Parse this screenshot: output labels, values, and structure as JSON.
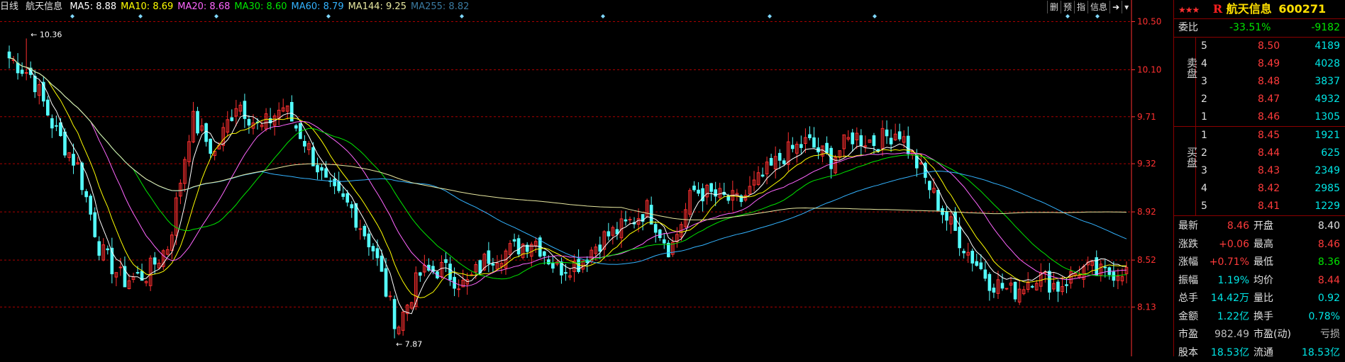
{
  "topbar": {
    "period": "日线",
    "stock": "航天信息",
    "ma": [
      {
        "label": "MA5: 8.88",
        "color": "#ffffff"
      },
      {
        "label": "MA10: 8.69",
        "color": "#ffff00"
      },
      {
        "label": "MA20: 8.68",
        "color": "#ff66ff"
      },
      {
        "label": "MA30: 8.60",
        "color": "#00e600"
      },
      {
        "label": "MA60: 8.79",
        "color": "#33b3ff"
      },
      {
        "label": "MA144: 9.25",
        "color": "#e8e8a0"
      },
      {
        "label": "MA255: 8.82",
        "color": "#3a7aa0"
      }
    ],
    "buttons": [
      "删",
      "预",
      "指",
      "信息"
    ],
    "arrow": "➔"
  },
  "chart_data": {
    "type": "candlestick",
    "ylim": [
      7.75,
      10.55
    ],
    "yticks": [
      "10.50",
      "10.10",
      "9.71",
      "9.32",
      "8.92",
      "8.52",
      "8.13"
    ],
    "yvals": [
      10.5,
      10.1,
      9.71,
      9.32,
      8.92,
      8.52,
      8.13
    ],
    "high_label": "10.36",
    "low_label": "7.87",
    "high": 10.36,
    "low": 7.87,
    "colors": {
      "up": "#ff3030",
      "down": "#54ffff",
      "grid": "#aa0000",
      "axis": "#ff3030"
    },
    "ma_colors": [
      "#ffffff",
      "#ffff00",
      "#ff66ff",
      "#00e600",
      "#33b3ff",
      "#e8e8a0"
    ],
    "ma_last": [
      8.88,
      8.69,
      8.68,
      8.6,
      8.79,
      9.25
    ],
    "key_closes": [
      10.2,
      10.05,
      9.6,
      9.3,
      8.6,
      8.35,
      8.4,
      8.65,
      9.7,
      9.4,
      9.85,
      9.6,
      9.8,
      9.5,
      9.1,
      8.95,
      8.6,
      7.95,
      8.4,
      8.45,
      8.3,
      8.55,
      8.6,
      8.7,
      8.45,
      8.5,
      8.7,
      8.8,
      8.95,
      8.6,
      9.1,
      9.05,
      9.0,
      9.2,
      9.4,
      9.5,
      9.35,
      9.55,
      9.5,
      9.6,
      9.25,
      8.9,
      8.6,
      8.35,
      8.25,
      8.4,
      8.3,
      8.45,
      8.4,
      8.46
    ]
  },
  "panel": {
    "title": "航天信息",
    "code": "600271",
    "stars": "★★★",
    "r_logo": "R",
    "weibi": {
      "label": "委比",
      "pct": "-33.51%",
      "diff": "-9182"
    },
    "sell_label": "卖盘",
    "buy_label": "买盘",
    "sell": [
      {
        "n": "5",
        "price": "8.50",
        "vol": "4189"
      },
      {
        "n": "4",
        "price": "8.49",
        "vol": "4028"
      },
      {
        "n": "3",
        "price": "8.48",
        "vol": "3837"
      },
      {
        "n": "2",
        "price": "8.47",
        "vol": "4932"
      },
      {
        "n": "1",
        "price": "8.46",
        "vol": "1305"
      }
    ],
    "buy": [
      {
        "n": "1",
        "price": "8.45",
        "vol": "1921"
      },
      {
        "n": "2",
        "price": "8.44",
        "vol": "625"
      },
      {
        "n": "3",
        "price": "8.43",
        "vol": "2349"
      },
      {
        "n": "4",
        "price": "8.42",
        "vol": "2985"
      },
      {
        "n": "5",
        "price": "8.41",
        "vol": "1229"
      }
    ],
    "quote": [
      {
        "l1": "最新",
        "v1": "8.46",
        "c1": "red",
        "l2": "开盘",
        "v2": "8.40",
        "c2": "white"
      },
      {
        "l1": "涨跌",
        "v1": "+0.06",
        "c1": "red",
        "l2": "最高",
        "v2": "8.46",
        "c2": "red"
      },
      {
        "l1": "涨幅",
        "v1": "+0.71%",
        "c1": "red",
        "l2": "最低",
        "v2": "8.36",
        "c2": "green"
      },
      {
        "l1": "振幅",
        "v1": "1.19%",
        "c1": "cyan",
        "l2": "均价",
        "v2": "8.44",
        "c2": "red"
      },
      {
        "l1": "总手",
        "v1": "14.42万",
        "c1": "cyan",
        "l2": "量比",
        "v2": "0.92",
        "c2": "cyan"
      },
      {
        "l1": "金额",
        "v1": "1.22亿",
        "c1": "cyan",
        "l2": "换手",
        "v2": "0.78%",
        "c2": "cyan"
      },
      {
        "l1": "市盈",
        "v1": "982.49",
        "c1": "grey",
        "l2": "市盈(动)",
        "v2": "亏损",
        "c2": "grey"
      },
      {
        "l1": "股本",
        "v1": "18.53亿",
        "c1": "cyan",
        "l2": "流通",
        "v2": "18.53亿",
        "c2": "cyan"
      }
    ]
  }
}
